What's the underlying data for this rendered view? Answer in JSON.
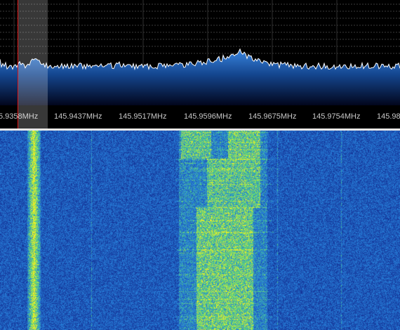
{
  "spectrum": {
    "freq_labels": [
      "5.9358MHz",
      "145.9437MHz",
      "145.9517MHz",
      "145.9596MHz",
      "145.9675MHz",
      "145.9754MHz",
      "145.98"
    ],
    "colors": {
      "background": "#000000",
      "grid": "#3c3c3c",
      "trace": "#ffffff",
      "fill_top": "#2a6fd0",
      "fill_bottom": "#02061c",
      "tuning_line": "#e01818"
    }
  },
  "waterfall": {
    "colors": {
      "low": "#1b3fb0",
      "mid": "#3a8ee0",
      "high": "#f2ea2a"
    }
  }
}
